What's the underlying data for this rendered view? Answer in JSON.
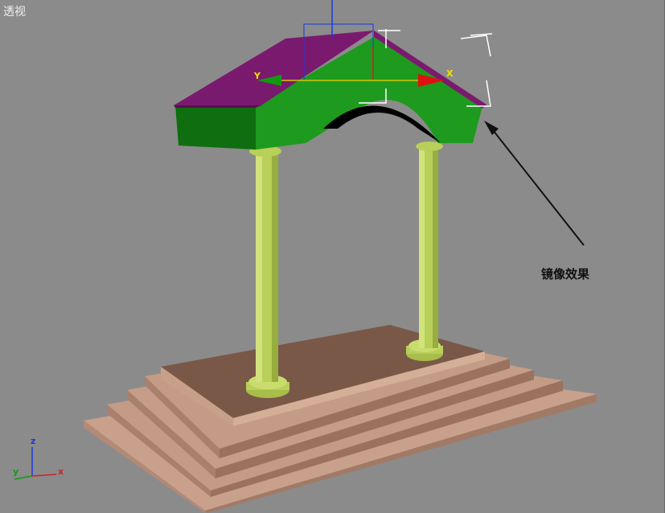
{
  "viewport": {
    "label": "透视",
    "annotation": "镜像效果"
  },
  "gizmo": {
    "x_label": "X",
    "y_label": "Y"
  },
  "axis_tripod": {
    "x_label": "x",
    "y_label": "y",
    "z_label": "z"
  },
  "colors": {
    "background": "#8b8b8b",
    "roof": "#7a1a6e",
    "arch": "#1e9a1e",
    "arch_dark": "#0f6e0f",
    "column": "#b8cf5a",
    "steps": "#c8a08a",
    "steps_dark": "#7d5a4a"
  }
}
